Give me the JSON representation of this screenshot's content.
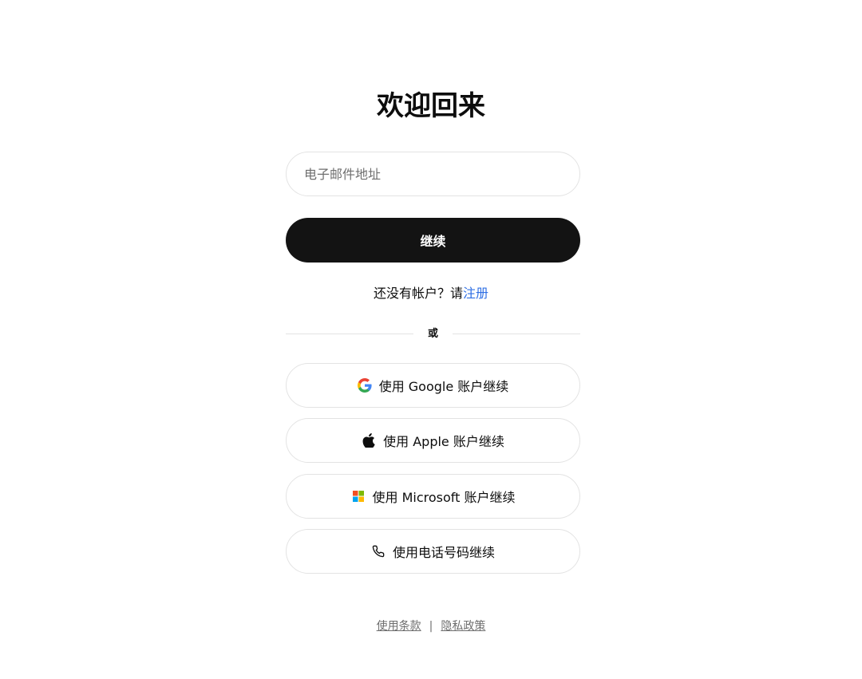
{
  "title": "欢迎回来",
  "email_field": {
    "placeholder": "电子邮件地址"
  },
  "continue_button": "继续",
  "signup": {
    "prompt": "还没有帐户？请",
    "link": "注册"
  },
  "divider_label": "或",
  "social_buttons": [
    {
      "label": "使用 Google 账户继续",
      "icon": "google-icon"
    },
    {
      "label": "使用 Apple 账户继续",
      "icon": "apple-icon"
    },
    {
      "label": "使用 Microsoft 账户继续",
      "icon": "microsoft-icon"
    },
    {
      "label": "使用电话号码继续",
      "icon": "phone-icon"
    }
  ],
  "footer": {
    "terms": "使用条款",
    "separator": "|",
    "privacy": "隐私政策"
  },
  "colors": {
    "primary_button": "#131313",
    "link": "#2f6fe4",
    "border": "#e3e3e3"
  }
}
